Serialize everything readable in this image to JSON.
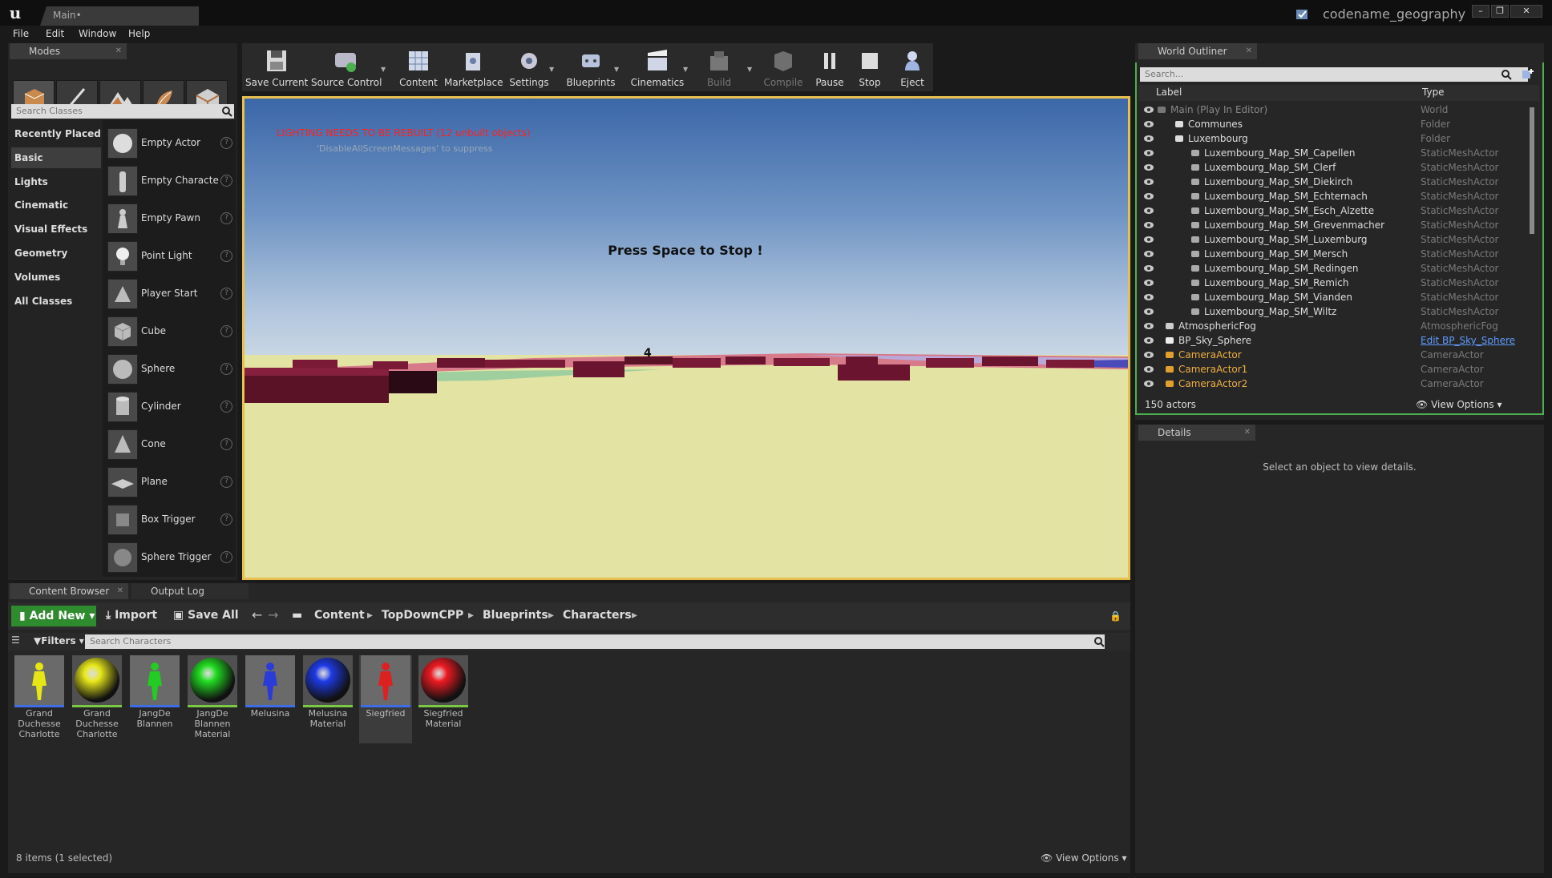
{
  "window": {
    "doc_tab": "Main•",
    "project": "codename_geography",
    "min": "–",
    "max": "❐",
    "close": "✕"
  },
  "menu": [
    "File",
    "Edit",
    "Window",
    "Help"
  ],
  "modes": {
    "tab": "Modes",
    "search_placeholder": "Search Classes",
    "categories": [
      "Recently Placed",
      "Basic",
      "Lights",
      "Cinematic",
      "Visual Effects",
      "Geometry",
      "Volumes",
      "All Classes"
    ],
    "items": [
      "Empty Actor",
      "Empty Characte",
      "Empty Pawn",
      "Point Light",
      "Player Start",
      "Cube",
      "Sphere",
      "Cylinder",
      "Cone",
      "Plane",
      "Box Trigger",
      "Sphere Trigger"
    ]
  },
  "toolbar": {
    "buttons": [
      "Save Current",
      "Source Control",
      "Content",
      "Marketplace",
      "Settings",
      "Blueprints",
      "Cinematics",
      "Build",
      "Compile",
      "Pause",
      "Stop",
      "Eject"
    ]
  },
  "viewport": {
    "warning": "LIGHTING NEEDS TO BE REBUILT (12 unbuilt objects)",
    "suppress": "'DisableAllScreenMessages' to suppress",
    "center_text": "Press Space to Stop !",
    "marker": "4"
  },
  "outliner": {
    "tab": "World Outliner",
    "search_placeholder": "Search...",
    "col_label": "Label",
    "col_type": "Type",
    "rows": [
      {
        "label": "Main (Play In Editor)",
        "type": "World"
      },
      {
        "label": "Communes",
        "type": "Folder"
      },
      {
        "label": "Luxembourg",
        "type": "Folder"
      },
      {
        "label": "Luxembourg_Map_SM_Capellen",
        "type": "StaticMeshActor"
      },
      {
        "label": "Luxembourg_Map_SM_Clerf",
        "type": "StaticMeshActor"
      },
      {
        "label": "Luxembourg_Map_SM_Diekirch",
        "type": "StaticMeshActor"
      },
      {
        "label": "Luxembourg_Map_SM_Echternach",
        "type": "StaticMeshActor"
      },
      {
        "label": "Luxembourg_Map_SM_Esch_Alzette",
        "type": "StaticMeshActor"
      },
      {
        "label": "Luxembourg_Map_SM_Grevenmacher",
        "type": "StaticMeshActor"
      },
      {
        "label": "Luxembourg_Map_SM_Luxemburg",
        "type": "StaticMeshActor"
      },
      {
        "label": "Luxembourg_Map_SM_Mersch",
        "type": "StaticMeshActor"
      },
      {
        "label": "Luxembourg_Map_SM_Redingen",
        "type": "StaticMeshActor"
      },
      {
        "label": "Luxembourg_Map_SM_Remich",
        "type": "StaticMeshActor"
      },
      {
        "label": "Luxembourg_Map_SM_Vianden",
        "type": "StaticMeshActor"
      },
      {
        "label": "Luxembourg_Map_SM_Wiltz",
        "type": "StaticMeshActor"
      },
      {
        "label": "AtmosphericFog",
        "type": "AtmosphericFog"
      },
      {
        "label": "BP_Sky_Sphere",
        "type": "Edit BP_Sky_Sphere"
      },
      {
        "label": "CameraActor",
        "type": "CameraActor"
      },
      {
        "label": "CameraActor1",
        "type": "CameraActor"
      },
      {
        "label": "CameraActor2",
        "type": "CameraActor"
      }
    ],
    "actor_count": "150 actors",
    "view_options": "View Options"
  },
  "details": {
    "tab": "Details",
    "empty": "Select an object to view details."
  },
  "content_browser": {
    "tab": "Content Browser",
    "tab2": "Output Log",
    "add_new": "Add New",
    "import": "Import",
    "save_all": "Save All",
    "path": [
      "Content",
      "TopDownCPP",
      "Blueprints",
      "Characters"
    ],
    "filters": "Filters",
    "search_placeholder": "Search Characters",
    "assets": [
      {
        "name": "Grand Duchesse Charlotte",
        "color": "#e6e614",
        "kind": "figure"
      },
      {
        "name": "Grand Duchesse Charlotte",
        "color": "#e8e81a",
        "kind": "sphere"
      },
      {
        "name": "JangDe Blannen",
        "color": "#22cc22",
        "kind": "figure"
      },
      {
        "name": "JangDe Blannen Material",
        "color": "#22dd22",
        "kind": "sphere"
      },
      {
        "name": "Melusina",
        "color": "#2a3bd8",
        "kind": "figure"
      },
      {
        "name": "Melusina Material",
        "color": "#1e3ae6",
        "kind": "sphere"
      },
      {
        "name": "Siegfried",
        "color": "#dd2020",
        "kind": "figure"
      },
      {
        "name": "Siegfried Material",
        "color": "#ee1a22",
        "kind": "sphere"
      }
    ],
    "status": "8 items (1 selected)",
    "view_options": "View Options"
  }
}
